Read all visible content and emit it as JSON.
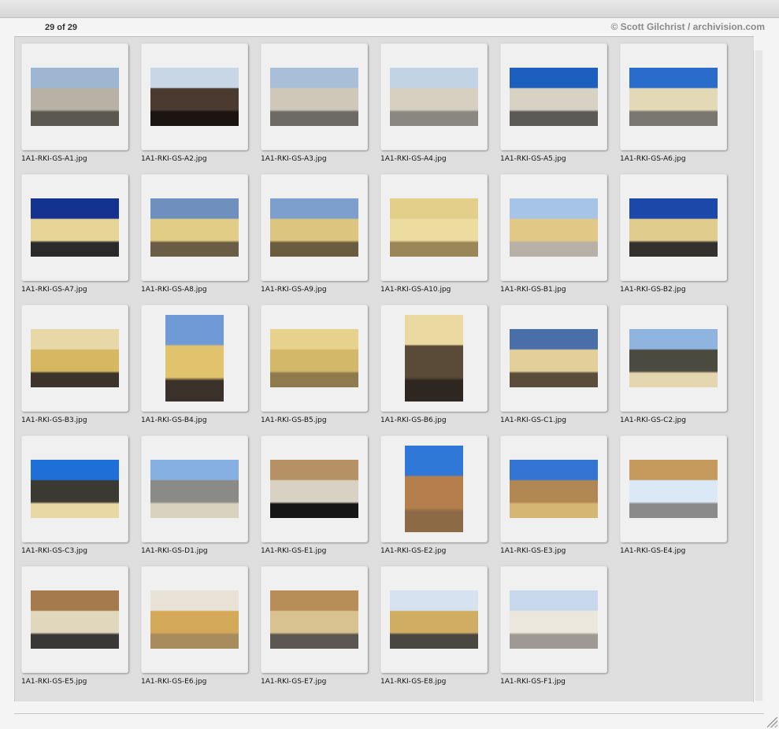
{
  "window": {
    "count_label": "29 of 29",
    "credit": "© Scott Gilchrist / archivision.com"
  },
  "thumbnails": [
    {
      "file": "1A1-RKI-GS-A1.jpg",
      "orientation": "landscape",
      "sky": "#9fb6d2",
      "mid": "#b8b2a6",
      "ground": "#5a5650"
    },
    {
      "file": "1A1-RKI-GS-A2.jpg",
      "orientation": "landscape",
      "sky": "#c9d6e6",
      "mid": "#4a3a30",
      "ground": "#1c1410"
    },
    {
      "file": "1A1-RKI-GS-A3.jpg",
      "orientation": "landscape",
      "sky": "#a9bfd9",
      "mid": "#cfc8b9",
      "ground": "#6d6a66"
    },
    {
      "file": "1A1-RKI-GS-A4.jpg",
      "orientation": "landscape",
      "sky": "#c3d3e6",
      "mid": "#d7d0c1",
      "ground": "#8a8780"
    },
    {
      "file": "1A1-RKI-GS-A5.jpg",
      "orientation": "landscape",
      "sky": "#1d5fbf",
      "mid": "#d8d2c4",
      "ground": "#5c5a57"
    },
    {
      "file": "1A1-RKI-GS-A6.jpg",
      "orientation": "landscape",
      "sky": "#2a6ccc",
      "mid": "#e3d9b6",
      "ground": "#7a7670"
    },
    {
      "file": "1A1-RKI-GS-A7.jpg",
      "orientation": "landscape",
      "sky": "#13328f",
      "mid": "#e7d497",
      "ground": "#2a2a2a"
    },
    {
      "file": "1A1-RKI-GS-A8.jpg",
      "orientation": "landscape",
      "sky": "#6f8fbf",
      "mid": "#e1cd86",
      "ground": "#6a5d45"
    },
    {
      "file": "1A1-RKI-GS-A9.jpg",
      "orientation": "landscape",
      "sky": "#7c9fce",
      "mid": "#dcc57e",
      "ground": "#6b5c40"
    },
    {
      "file": "1A1-RKI-GS-A10.jpg",
      "orientation": "landscape",
      "sky": "#e3cf89",
      "mid": "#ecdc9f",
      "ground": "#9a8656"
    },
    {
      "file": "1A1-RKI-GS-B1.jpg",
      "orientation": "landscape",
      "sky": "#a6c4e6",
      "mid": "#e1c887",
      "ground": "#b6b0a6"
    },
    {
      "file": "1A1-RKI-GS-B2.jpg",
      "orientation": "landscape",
      "sky": "#1c48aa",
      "mid": "#e0cc8d",
      "ground": "#34302b"
    },
    {
      "file": "1A1-RKI-GS-B3.jpg",
      "orientation": "landscape",
      "sky": "#e8d8a8",
      "mid": "#d6b863",
      "ground": "#3c342a"
    },
    {
      "file": "1A1-RKI-GS-B4.jpg",
      "orientation": "portrait",
      "sky": "#6f9ad6",
      "mid": "#e1c36e",
      "ground": "#3a322a"
    },
    {
      "file": "1A1-RKI-GS-B5.jpg",
      "orientation": "landscape",
      "sky": "#e6d28d",
      "mid": "#d4b86a",
      "ground": "#8e7a4c"
    },
    {
      "file": "1A1-RKI-GS-B6.jpg",
      "orientation": "portrait",
      "sky": "#ead9a0",
      "mid": "#5a4a38",
      "ground": "#2e2620"
    },
    {
      "file": "1A1-RKI-GS-C1.jpg",
      "orientation": "landscape",
      "sky": "#4a6ea8",
      "mid": "#e2cf9a",
      "ground": "#5a4e3a"
    },
    {
      "file": "1A1-RKI-GS-C2.jpg",
      "orientation": "landscape",
      "sky": "#8fb4e0",
      "mid": "#4a4a40",
      "ground": "#e4d7b0"
    },
    {
      "file": "1A1-RKI-GS-C3.jpg",
      "orientation": "landscape",
      "sky": "#1f6fd9",
      "mid": "#3a3a32",
      "ground": "#e8d9a4"
    },
    {
      "file": "1A1-RKI-GS-D1.jpg",
      "orientation": "landscape",
      "sky": "#86b0e2",
      "mid": "#8a8a86",
      "ground": "#d9d2bf"
    },
    {
      "file": "1A1-RKI-GS-E1.jpg",
      "orientation": "landscape",
      "sky": "#b69166",
      "mid": "#d8d2c2",
      "ground": "#151515"
    },
    {
      "file": "1A1-RKI-GS-E2.jpg",
      "orientation": "portrait",
      "sky": "#2f78d8",
      "mid": "#b47f4c",
      "ground": "#8d6a46"
    },
    {
      "file": "1A1-RKI-GS-E3.jpg",
      "orientation": "landscape",
      "sky": "#3474d2",
      "mid": "#b08752",
      "ground": "#d6b673"
    },
    {
      "file": "1A1-RKI-GS-E4.jpg",
      "orientation": "landscape",
      "sky": "#c59a5c",
      "mid": "#dbe8f6",
      "ground": "#8a8a8a"
    },
    {
      "file": "1A1-RKI-GS-E5.jpg",
      "orientation": "landscape",
      "sky": "#a57a4c",
      "mid": "#e1d7bd",
      "ground": "#3a3836"
    },
    {
      "file": "1A1-RKI-GS-E6.jpg",
      "orientation": "landscape",
      "sky": "#e8e3d6",
      "mid": "#d4a95a",
      "ground": "#a88c5e"
    },
    {
      "file": "1A1-RKI-GS-E7.jpg",
      "orientation": "landscape",
      "sky": "#b88e58",
      "mid": "#d8c28f",
      "ground": "#5c5650"
    },
    {
      "file": "1A1-RKI-GS-E8.jpg",
      "orientation": "landscape",
      "sky": "#d6e2ef",
      "mid": "#cfae63",
      "ground": "#4a4642"
    },
    {
      "file": "1A1-RKI-GS-F1.jpg",
      "orientation": "landscape",
      "sky": "#c7d8ec",
      "mid": "#ece7dc",
      "ground": "#9e9a93"
    }
  ]
}
